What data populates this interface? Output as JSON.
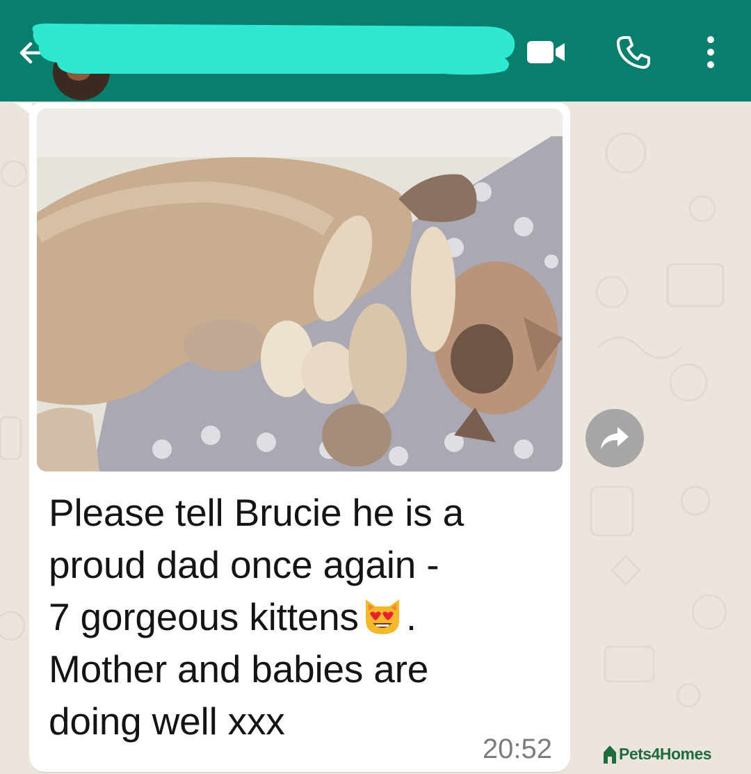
{
  "header": {
    "back_icon": "arrow-left-icon",
    "contact_name": "",
    "video_icon": "video-camera-icon",
    "call_icon": "phone-icon",
    "menu_icon": "more-vertical-icon",
    "colors": {
      "bar": "#087e6d",
      "redaction": "#2ee8d2"
    }
  },
  "message": {
    "image_alt": "mother cat with seven newborn kittens",
    "lines": [
      "Please tell Brucie he is a",
      "proud dad once again -",
      "7 gorgeous kittens",
      ".",
      "Mother and babies are",
      "doing well xxx"
    ],
    "emoji": "smiling-cat-heart-eyes-emoji",
    "time": "20:52"
  },
  "forward_icon": "share-forward-icon",
  "watermark": {
    "logo": "pets4homes-logo-icon",
    "text": "Pets4Homes"
  }
}
